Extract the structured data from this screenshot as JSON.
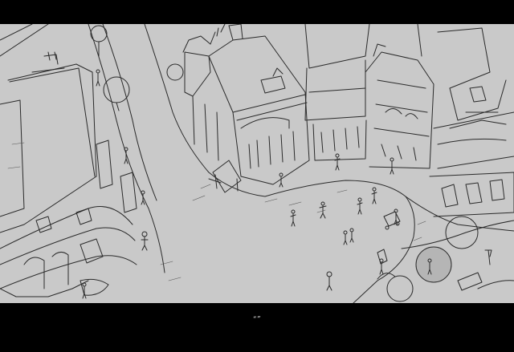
{
  "subtitle": "“”",
  "colors": {
    "letterbox": "#000000",
    "sketch_paper": "#c9c9c9",
    "sketch_line": "#2a2a2a",
    "subtitle_text": "#e6e6e6"
  }
}
